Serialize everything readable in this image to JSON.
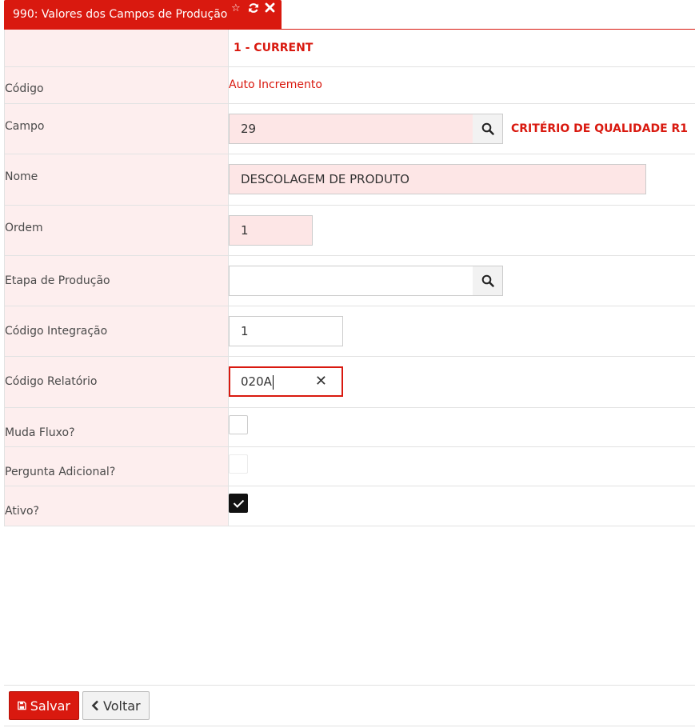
{
  "tab": {
    "title": "990: Valores dos Campos de Produção"
  },
  "header": {
    "record": "1 - CURRENT"
  },
  "fields": {
    "codigo": {
      "label": "Código",
      "value": "Auto Incremento"
    },
    "campo": {
      "label": "Campo",
      "value": "29",
      "description": "CRITÉRIO DE QUALIDADE R1"
    },
    "nome": {
      "label": "Nome",
      "value": "DESCOLAGEM DE PRODUTO"
    },
    "ordem": {
      "label": "Ordem",
      "value": "1"
    },
    "etapa": {
      "label": "Etapa de Produção",
      "value": ""
    },
    "codigo_integracao": {
      "label": "Código Integração",
      "value": "1"
    },
    "codigo_relatorio": {
      "label": "Código Relatório",
      "value": "020A"
    },
    "muda_fluxo": {
      "label": "Muda Fluxo?",
      "checked": false
    },
    "pergunta_adicional": {
      "label": "Pergunta Adicional?",
      "checked": false,
      "disabled": true
    },
    "ativo": {
      "label": "Ativo?",
      "checked": true
    }
  },
  "footer": {
    "save_label": "Salvar",
    "back_label": "Voltar"
  },
  "colors": {
    "accent": "#d9190f",
    "label_bg": "#fdeeee",
    "required_bg": "#fde6e6"
  }
}
